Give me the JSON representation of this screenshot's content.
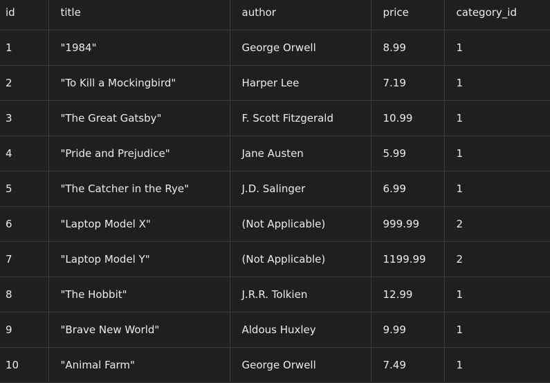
{
  "columns": [
    "id",
    "title",
    "author",
    "price",
    "category_id"
  ],
  "rows": [
    [
      "1",
      "\"1984\"",
      "George Orwell",
      "8.99",
      "1"
    ],
    [
      "2",
      "\"To Kill a Mockingbird\"",
      "Harper Lee",
      "7.19",
      "1"
    ],
    [
      "3",
      "\"The Great Gatsby\"",
      "F. Scott Fitzgerald",
      "10.99",
      "1"
    ],
    [
      "4",
      "\"Pride and Prejudice\"",
      "Jane Austen",
      "5.99",
      "1"
    ],
    [
      "5",
      "\"The Catcher in the Rye\"",
      "J.D. Salinger",
      "6.99",
      "1"
    ],
    [
      "6",
      "\"Laptop Model X\"",
      "(Not Applicable)",
      "999.99",
      "2"
    ],
    [
      "7",
      "\"Laptop Model Y\"",
      "(Not Applicable)",
      "1199.99",
      "2"
    ],
    [
      "8",
      "\"The Hobbit\"",
      "J.R.R. Tolkien",
      "12.99",
      "1"
    ],
    [
      "9",
      "\"Brave New World\"",
      "Aldous Huxley",
      "9.99",
      "1"
    ],
    [
      "10",
      "\"Animal Farm\"",
      "George Orwell",
      "7.49",
      "1"
    ]
  ]
}
